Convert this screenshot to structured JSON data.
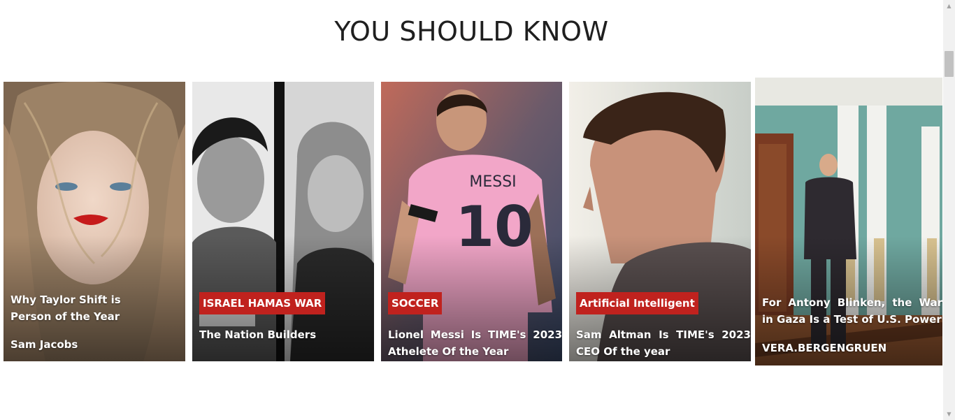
{
  "section": {
    "title": "YOU SHOULD KNOW"
  },
  "cards": [
    {
      "badge": "",
      "headline": "Why Taylor Shift is Person of the Year",
      "author": "Sam Jacobs"
    },
    {
      "badge": "ISRAEL HAMAS WAR",
      "headline": "The Nation Builders",
      "author": ""
    },
    {
      "badge": "SOCCER",
      "headline": "Lionel Messi Is TIME's 2023 Athelete Of the Year",
      "author": ""
    },
    {
      "badge": "Artificial Intelligent",
      "headline": "Sam Altman Is TIME's 2023 CEO Of the year",
      "author": ""
    },
    {
      "badge": "",
      "headline": "For Antony Blinken, the War in Gaza Is a Test of U.S. Power",
      "author": "VERA.BERGENGRUEN"
    }
  ],
  "jersey": {
    "name": "MESSI",
    "number": "10"
  },
  "colors": {
    "badge": "#c0221e",
    "title": "#1f1f1f"
  },
  "icons": [
    "scroll-up-arrow-icon",
    "scroll-down-arrow-icon"
  ]
}
